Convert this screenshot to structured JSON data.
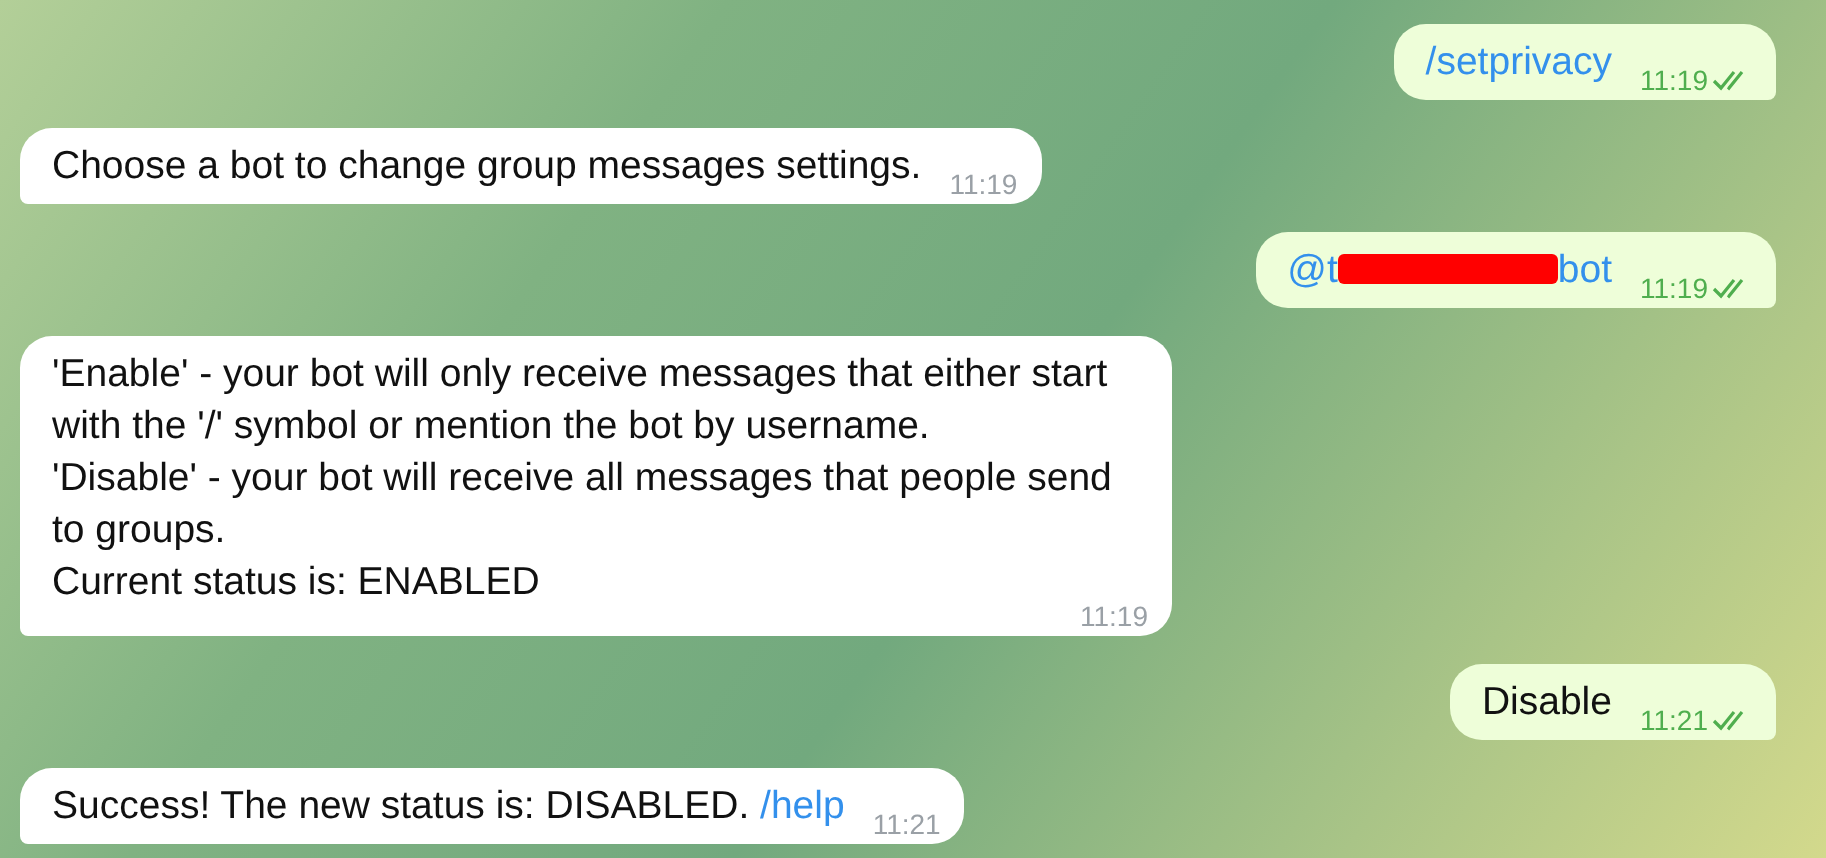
{
  "messages": [
    {
      "kind": "outgoing",
      "parts": [
        {
          "kind": "link",
          "text": "/setprivacy"
        }
      ],
      "time": "11:19",
      "read": true
    },
    {
      "kind": "incoming",
      "parts": [
        {
          "kind": "text",
          "text": "Choose a bot to change group messages settings."
        }
      ],
      "time": "11:19"
    },
    {
      "kind": "outgoing",
      "parts": [
        {
          "kind": "link",
          "text": "@t"
        },
        {
          "kind": "redacted"
        },
        {
          "kind": "link",
          "text": "bot"
        }
      ],
      "time": "11:19",
      "read": true
    },
    {
      "kind": "incoming",
      "parts": [
        {
          "kind": "text",
          "text": "'Enable' - your bot will only receive messages that either start with the '/' symbol or mention the bot by username.\n'Disable' - your bot will receive all messages that people send to groups.\nCurrent status is: ENABLED"
        }
      ],
      "time": "11:19"
    },
    {
      "kind": "outgoing",
      "parts": [
        {
          "kind": "text",
          "text": "Disable"
        }
      ],
      "time": "11:21",
      "read": true
    },
    {
      "kind": "incoming",
      "parts": [
        {
          "kind": "text",
          "text": "Success! The new status is: DISABLED. "
        },
        {
          "kind": "link",
          "text": "/help"
        }
      ],
      "time": "11:21"
    }
  ]
}
